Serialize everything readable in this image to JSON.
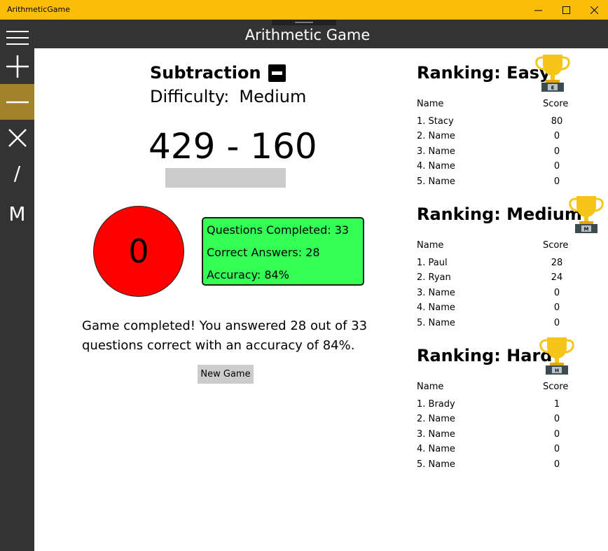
{
  "window": {
    "title": "ArithmeticGame"
  },
  "app": {
    "title": "Arithmetic Game"
  },
  "nav": {
    "items": [
      {
        "name": "menu",
        "icon": "hamburger-icon"
      },
      {
        "name": "addition",
        "icon": "plus-icon"
      },
      {
        "name": "subtraction",
        "icon": "minus-icon",
        "active": true
      },
      {
        "name": "multiplication",
        "icon": "times-icon"
      },
      {
        "name": "division",
        "icon": "slash-icon",
        "label": "/"
      },
      {
        "name": "mixed",
        "icon": "m-icon",
        "label": "M"
      }
    ],
    "active_color": "#a0832b",
    "background": "#333333"
  },
  "game": {
    "operation": "Subtraction",
    "difficulty_label": "Difficulty:",
    "difficulty": "Medium",
    "problem": "429 - 160",
    "answer_value": "",
    "timer": "0",
    "timer_color": "#ff0000",
    "stats": {
      "completed": "Questions Completed: 33",
      "correct": "Correct Answers: 28",
      "accuracy": "Accuracy: 84%"
    },
    "stats_color": "#33ff55",
    "result": "Game completed! You answered 28 out of 33 questions correct with an accuracy of 84%.",
    "new_game": "New Game"
  },
  "rankings": [
    {
      "title": "Ranking: Easy",
      "badge": "E",
      "name_header": "Name",
      "score_header": "Score",
      "rows": [
        {
          "name": "1. Stacy",
          "score": "80"
        },
        {
          "name": "2. Name",
          "score": "0"
        },
        {
          "name": "3. Name",
          "score": "0"
        },
        {
          "name": "4. Name",
          "score": "0"
        },
        {
          "name": "5. Name",
          "score": "0"
        }
      ]
    },
    {
      "title": "Ranking: Medium",
      "badge": "M",
      "name_header": "Name",
      "score_header": "Score",
      "rows": [
        {
          "name": "1. Paul",
          "score": "28"
        },
        {
          "name": "2. Ryan",
          "score": "24"
        },
        {
          "name": "3. Name",
          "score": "0"
        },
        {
          "name": "4. Name",
          "score": "0"
        },
        {
          "name": "5. Name",
          "score": "0"
        }
      ]
    },
    {
      "title": "Ranking: Hard",
      "badge": "H",
      "name_header": "Name",
      "score_header": "Score",
      "rows": [
        {
          "name": "1. Brady",
          "score": "1"
        },
        {
          "name": "2. Name",
          "score": "0"
        },
        {
          "name": "3. Name",
          "score": "0"
        },
        {
          "name": "4. Name",
          "score": "0"
        },
        {
          "name": "5. Name",
          "score": "0"
        }
      ]
    }
  ],
  "colors": {
    "titlebar": "#fbbd08",
    "header": "#333333",
    "trophy_gold": "#f5c518",
    "trophy_base": "#3c4a52"
  }
}
